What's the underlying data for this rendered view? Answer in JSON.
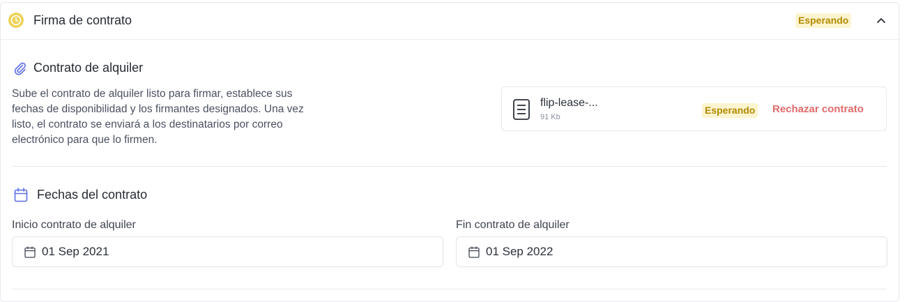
{
  "header": {
    "title": "Firma de contrato",
    "status": "Esperando",
    "icons": {
      "status": "clock-icon",
      "toggle": "chevron-up-icon"
    },
    "colors": {
      "accent": "#e9c43c",
      "badge_bg": "#fbf4cf",
      "badge_text": "#b38a00"
    }
  },
  "contract_section": {
    "title": "Contrato de alquiler",
    "icon": "paperclip-icon",
    "description": "Sube el contrato de alquiler listo para firmar, establece sus fechas de disponibilidad y los firmantes designados. Una vez listo, el contrato se enviará a los destinatarios por correo electrónico para que lo firmen.",
    "file": {
      "name": "flip-lease-...",
      "size": "91 Kb",
      "status": "Esperando",
      "reject_label": "Rechazar contrato",
      "icon": "document-icon"
    }
  },
  "dates_section": {
    "title": "Fechas del contrato",
    "icon": "calendar-icon",
    "start": {
      "label": "Inicio contrato de alquiler",
      "value": "01 Sep 2021"
    },
    "end": {
      "label": "Fin contrato de alquiler",
      "value": "01 Sep 2022"
    },
    "colors": {
      "icon": "#5b6ee1",
      "reject": "#e36a6a"
    }
  }
}
